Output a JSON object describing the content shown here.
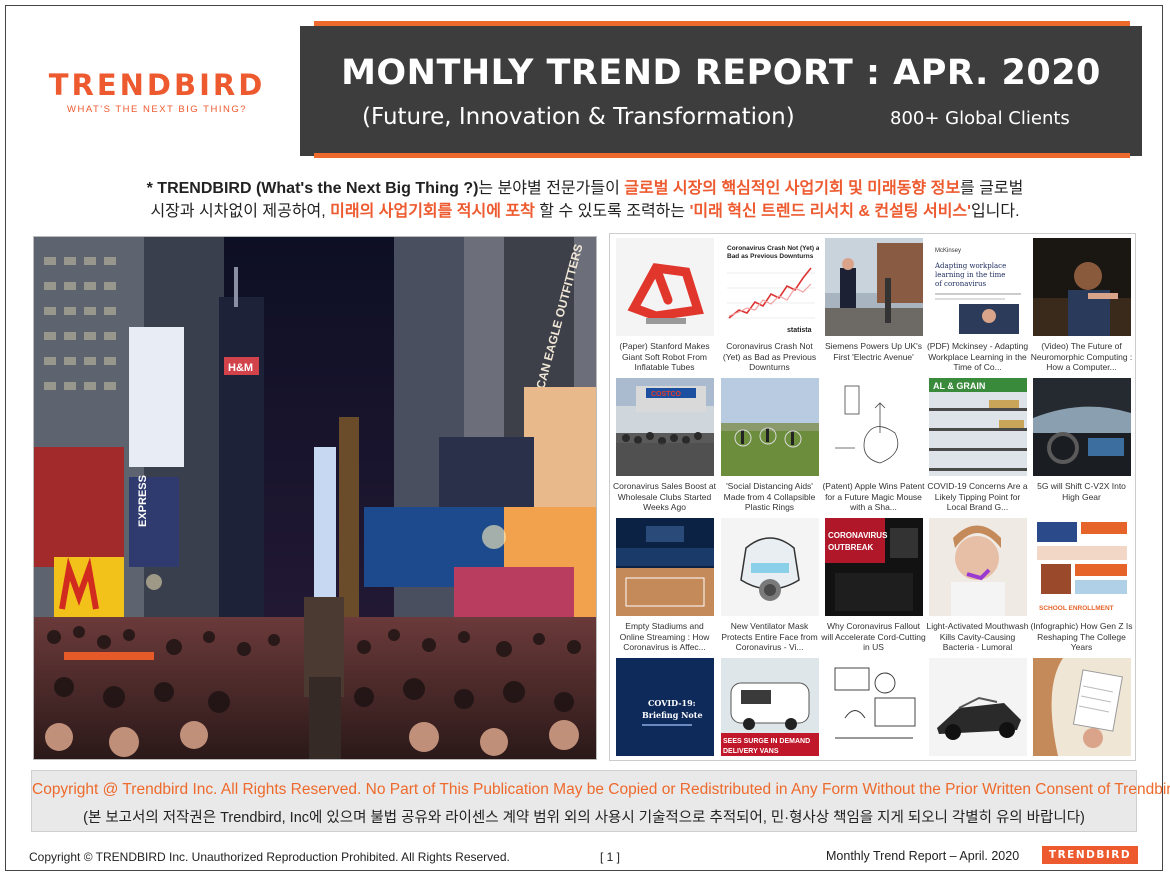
{
  "brand": {
    "name": "TRENDBIRD",
    "tagline": "WHAT'S THE NEXT BIG THING?",
    "accent_color": "#ee5a2f"
  },
  "banner": {
    "title": "MONTHLY TREND REPORT : APR. 2020",
    "subtitle": "(Future, Innovation & Transformation)",
    "clients": "800+ Global Clients",
    "background": "#3d3d3d"
  },
  "intro": {
    "p1": "* TRENDBIRD (What's the Next Big Thing ?)",
    "p2": "는 분야별 전문가들이 ",
    "p3": "글로벌 시장의 핵심적인 사업기회 및 미래동향 정보",
    "p4": "를 글로벌",
    "p5": "시장과 시차없이 제공하여, ",
    "p6": "미래의 사업기회를 적시에 포착",
    "p7": " 할 수 있도록 조력하는 ",
    "p8": "'미래 혁신 트렌드 리서치 & 컨설팅 서비스'",
    "p9": "입니다."
  },
  "photo_text": {
    "sign1": "AMERICAN EAGLE OUTFITTERS",
    "sign2": "H&M",
    "sign3": "EXPRESS"
  },
  "articles": [
    {
      "caption": "(Paper) Stanford Makes Giant Soft Robot From Inflatable Tubes"
    },
    {
      "caption": "Coronavirus Crash Not (Yet) as Bad as Previous Downturns",
      "thumb_title": "Coronavirus Crash Not (Yet) as Bad as Previous Downturns",
      "thumb_brand": "statista"
    },
    {
      "caption": "Siemens Powers Up UK's First 'Electric Avenue'"
    },
    {
      "caption": "(PDF) Mckinsey - Adapting Workplace Learning in the Time of Co...",
      "thumb_title": "Adapting workplace learning in the time of coronavirus",
      "thumb_brand": "McKinsey"
    },
    {
      "caption": "(Video) The Future of Neuromorphic Computing : How a Computer..."
    },
    {
      "caption": "Coronavirus Sales Boost at Wholesale Clubs Started Weeks Ago",
      "thumb_text": "COSTCO"
    },
    {
      "caption": "'Social Distancing Aids' Made from 4 Collapsible Plastic Rings"
    },
    {
      "caption": "(Patent) Apple Wins Patent for a Future Magic Mouse with a Sha..."
    },
    {
      "caption": "COVID-19 Concerns Are a Likely Tipping Point for Local Brand G...",
      "thumb_text": "AL & GRAIN"
    },
    {
      "caption": "5G will Shift C-V2X Into High Gear"
    },
    {
      "caption": "Empty Stadiums and Online Streaming : How Coronavirus is Affec..."
    },
    {
      "caption": "New Ventilator Mask Protects Entire Face from Coronavirus - Vi..."
    },
    {
      "caption": "Why Coronavirus Fallout will Accelerate Cord-Cutting in US",
      "thumb_text": "CORONAVIRUS OUTBREAK"
    },
    {
      "caption": "Light-Activated Mouthwash Kills Cavity-Causing Bacteria - Lumoral"
    },
    {
      "caption": "(Infographic) How Gen Z Is Reshaping The College Years",
      "thumb_text": "SCHOOL ENROLLMENT"
    },
    {
      "caption": "",
      "thumb_title": "COVID-19: Briefing Note"
    },
    {
      "caption": "",
      "thumb_text": "SEES SURGE IN DEMAND DELIVERY VANS"
    },
    {
      "caption": ""
    },
    {
      "caption": ""
    },
    {
      "caption": ""
    }
  ],
  "notice": {
    "english": "Copyright @ Trendbird Inc. All Rights Reserved. No Part of This Publication May be Copied or Redistributed in Any Form Without the Prior Written Consent of Trendbird.",
    "korean": "(본 보고서의 저작권은 Trendbird, Inc에 있으며 불법 공유와 라이센스 계약 범위 외의 사용시 기술적으로 추적되어, 민·형사상 책임을 지게 되오니 각별히 유의 바랍니다)"
  },
  "footer": {
    "copyright": "Copyright © TRENDBIRD Inc. Unauthorized Reproduction Prohibited. All Rights Reserved.",
    "page": "[ 1 ]",
    "report": "Monthly Trend Report – April. 2020",
    "logo": "TRENDBIRD"
  }
}
